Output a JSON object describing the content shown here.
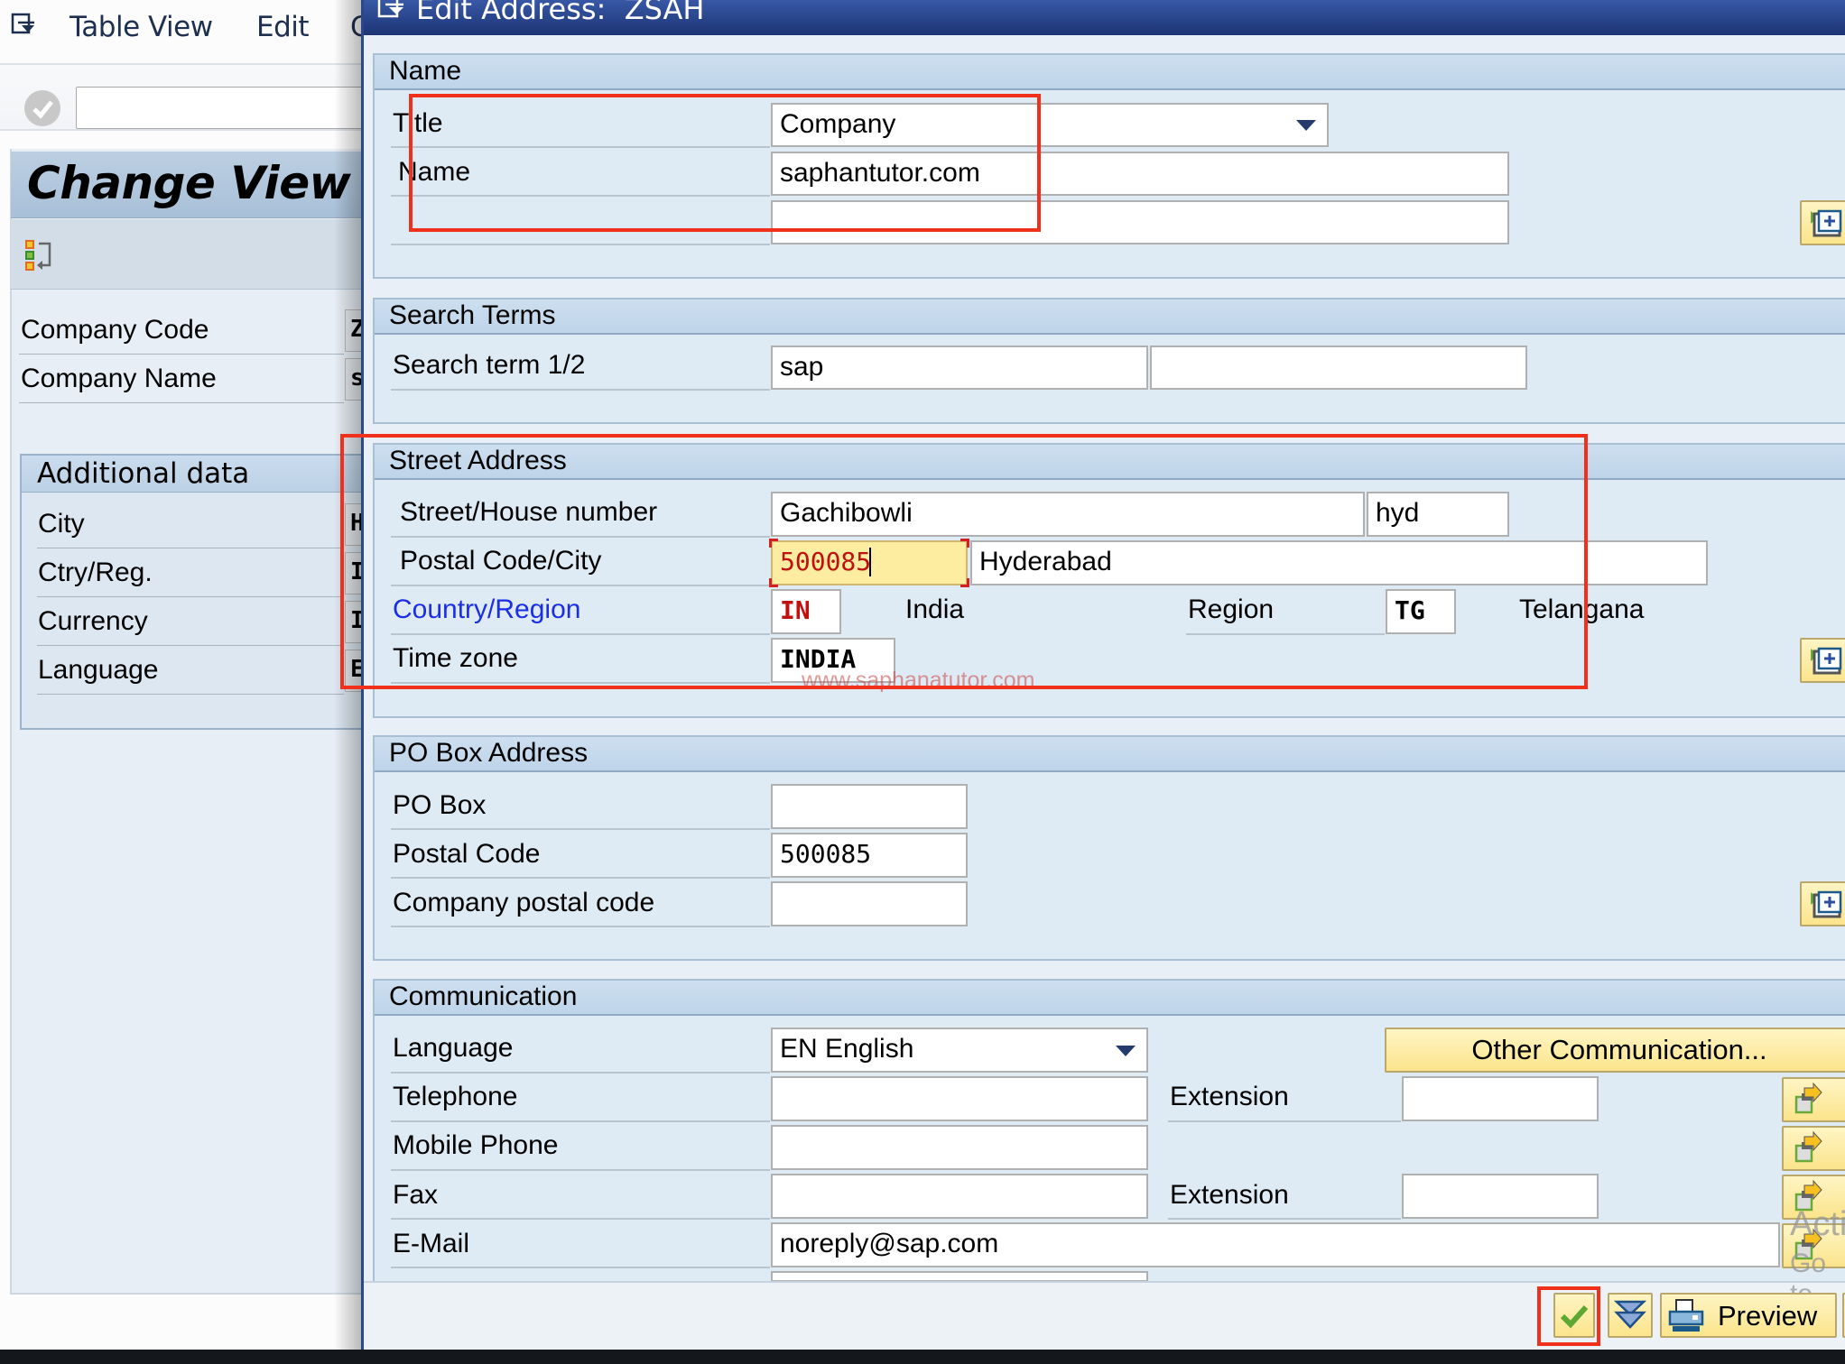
{
  "background_window": {
    "menu": [
      {
        "label": "Table View",
        "accesskey_index": 0
      },
      {
        "label": "Edit",
        "accesskey_index": 0
      },
      {
        "label": "G",
        "accesskey_index": 0
      }
    ],
    "title": "Change View \"C",
    "fields": [
      {
        "label": "Company Code",
        "value_stub": "Z"
      },
      {
        "label": "Company Name",
        "value_stub": "s"
      }
    ],
    "additional_data": {
      "title": "Additional data",
      "fields": [
        {
          "label": "City",
          "value_stub": "H"
        },
        {
          "label": "Ctry/Reg.",
          "value_stub": "I"
        },
        {
          "label": "Currency",
          "value_stub": "I"
        },
        {
          "label": "Language",
          "value_stub": "E"
        }
      ]
    }
  },
  "dialog": {
    "title": "Edit Address:  ZSAH",
    "sections": {
      "name": {
        "title": "Name",
        "title_label": "Title",
        "title_value": "Company",
        "name_label": "Name",
        "name_value": "saphantutor.com",
        "name2_value": ""
      },
      "search_terms": {
        "title": "Search Terms",
        "label": "Search term 1/2",
        "term1": "sap",
        "term2": ""
      },
      "street_address": {
        "title": "Street Address",
        "street_label": "Street/House number",
        "street_value": "Gachibowli",
        "house_number": "hyd",
        "postal_city_label": "Postal Code/City",
        "postal_code": "500085",
        "city": "Hyderabad",
        "country_label": "Country/Region",
        "country_code": "IN",
        "country_name": "India",
        "region_label": "Region",
        "region_code": "TG",
        "region_name": "Telangana",
        "timezone_label": "Time zone",
        "timezone_value": "INDIA"
      },
      "po_box": {
        "title": "PO Box Address",
        "po_box_label": "PO Box",
        "po_box_value": "",
        "postal_code_label": "Postal Code",
        "postal_code_value": "500085",
        "company_postal_label": "Company postal code",
        "company_postal_value": ""
      },
      "communication": {
        "title": "Communication",
        "language_label": "Language",
        "language_value": "EN English",
        "other_comm_button": "Other Communication...",
        "telephone_label": "Telephone",
        "telephone_value": "",
        "extension_label": "Extension",
        "telephone_ext_value": "",
        "mobile_label": "Mobile Phone",
        "mobile_value": "",
        "fax_label": "Fax",
        "fax_value": "",
        "fax_ext_label": "Extension",
        "fax_ext_value": "",
        "email_label": "E-Mail",
        "email_value": "noreply@sap.com"
      }
    },
    "footer": {
      "confirm_icon": "checkmark-icon",
      "expand_icon": "double-chevron-down-icon",
      "preview_label": "Preview"
    }
  },
  "watermarks": {
    "site": "www.saphanatutor.com",
    "activate_windows_1": "Acti",
    "activate_windows_2": "Go to"
  },
  "colors": {
    "dialog_titlebar": "#1c3474",
    "section_header": "#bed4e9",
    "focus_field": "#fdeda0",
    "highlight_box": "#f0301a",
    "link": "#1a2ee6",
    "button": "#fbe48c"
  }
}
